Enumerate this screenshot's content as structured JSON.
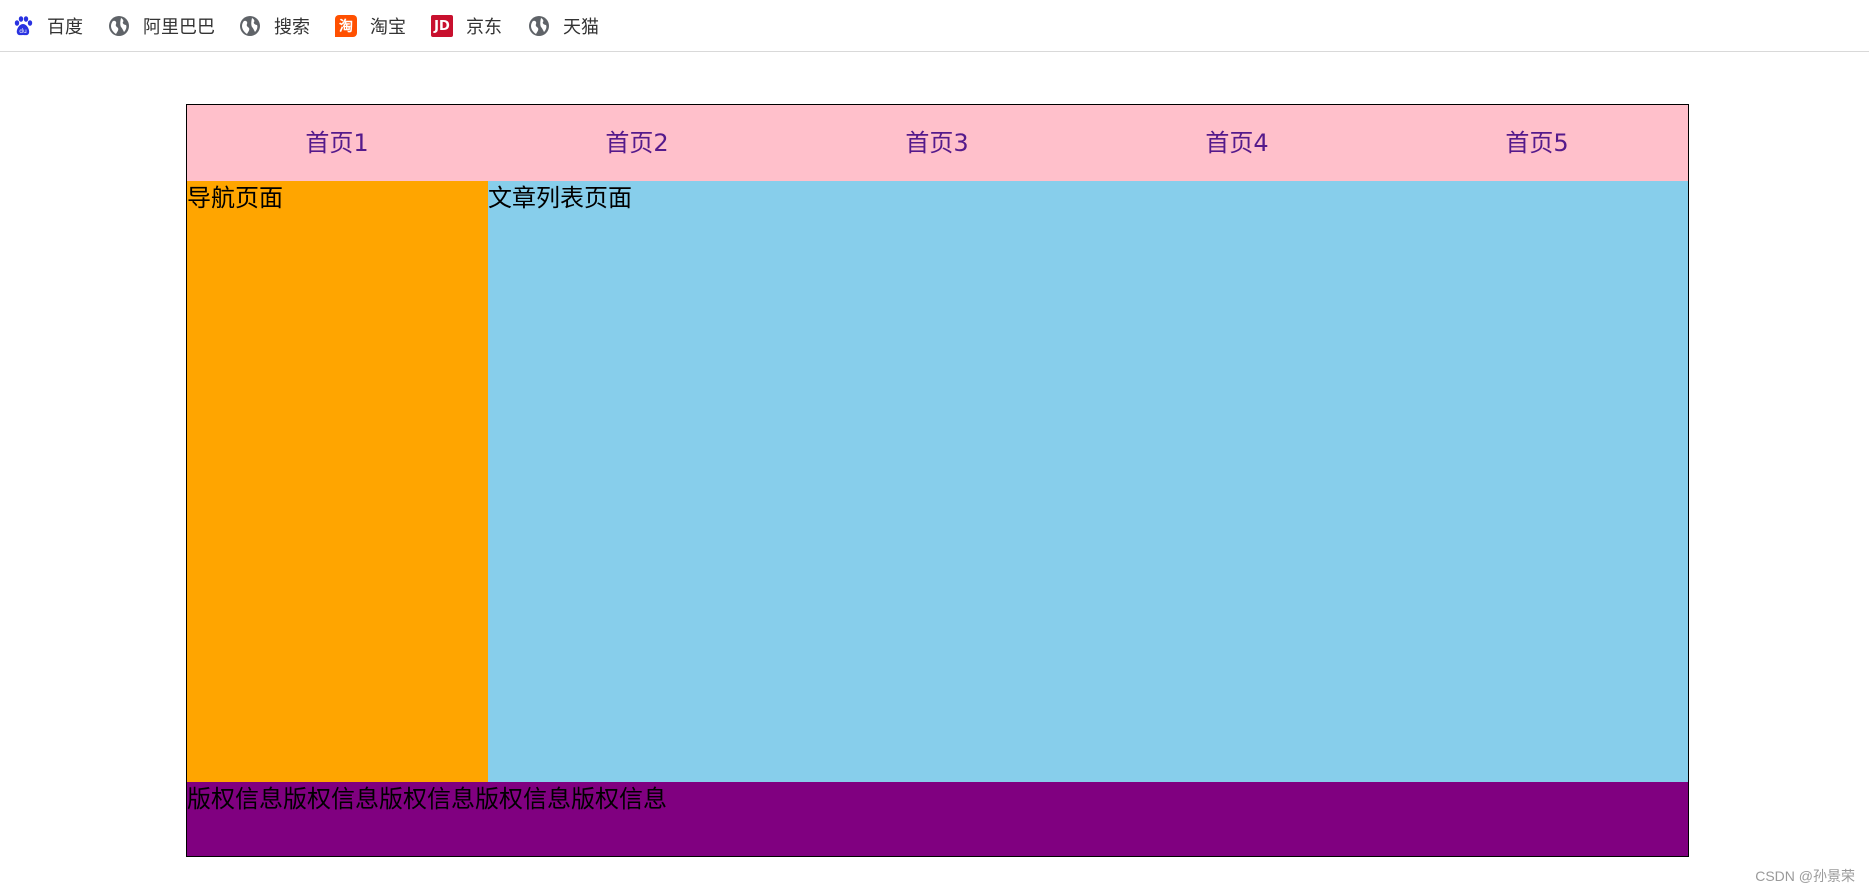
{
  "bookmarks": [
    {
      "label": "百度",
      "icon": "baidu-paw-icon"
    },
    {
      "label": "阿里巴巴",
      "icon": "globe-icon"
    },
    {
      "label": "搜索",
      "icon": "globe-icon"
    },
    {
      "label": "淘宝",
      "icon": "taobao-icon",
      "icon_text": "淘"
    },
    {
      "label": "京东",
      "icon": "jd-icon",
      "icon_text": "JD"
    },
    {
      "label": "天猫",
      "icon": "globe-icon"
    }
  ],
  "nav": {
    "links": [
      "首页1",
      "首页2",
      "首页3",
      "首页4",
      "首页5"
    ],
    "link_color": "#551a8b",
    "background": "#ffc0cb"
  },
  "sidebar": {
    "text": "导航页面",
    "background": "#ffa500"
  },
  "main": {
    "text": "文章列表页面",
    "background": "#87ceeb"
  },
  "footer": {
    "text": "版权信息版权信息版权信息版权信息版权信息",
    "background": "#800080"
  },
  "watermark": "CSDN @孙景荣"
}
